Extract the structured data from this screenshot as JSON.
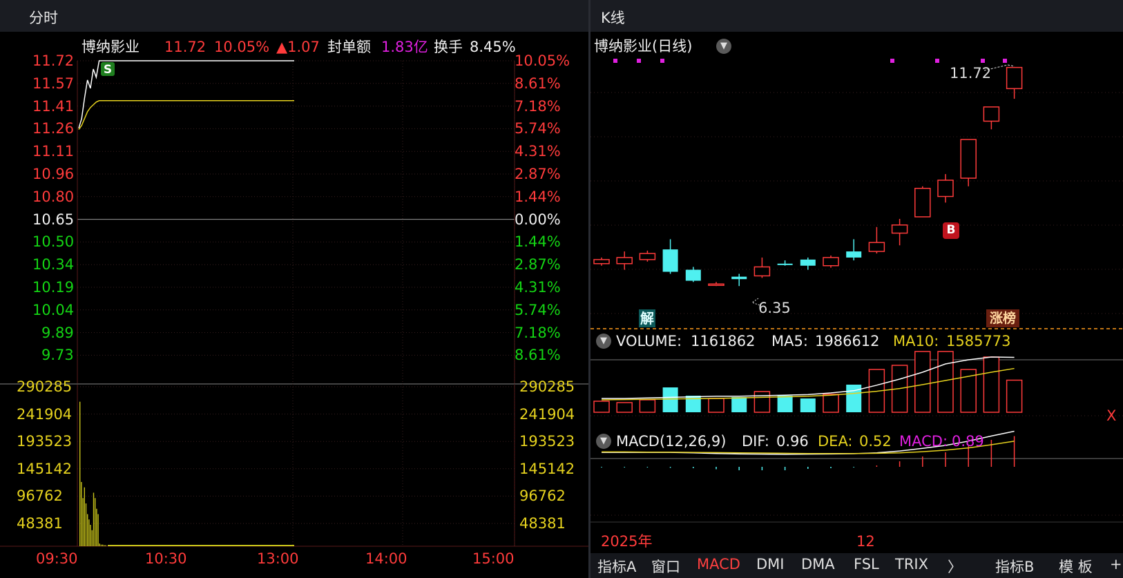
{
  "left_panel": {
    "title": "分时",
    "stock_name": "博纳影业",
    "price": "11.72",
    "pct": "10.05%",
    "change": "▲1.07",
    "seal_label": "封单额",
    "seal_value": "1.83亿",
    "turnover_label": "换手",
    "turnover_value": "8.45%",
    "s_marker": "S",
    "price_ticks_red": [
      "11.72",
      "11.57",
      "11.41",
      "11.26",
      "11.11",
      "10.96",
      "10.80"
    ],
    "price_mid": "10.65",
    "price_ticks_green": [
      "10.50",
      "10.34",
      "10.19",
      "10.04",
      "9.89",
      "9.73"
    ],
    "pct_ticks_red": [
      "10.05%",
      "8.61%",
      "7.18%",
      "5.74%",
      "4.31%",
      "2.87%",
      "1.44%"
    ],
    "pct_mid": "0.00%",
    "pct_ticks_green": [
      "1.44%",
      "2.87%",
      "4.31%",
      "5.74%",
      "7.18%",
      "8.61%"
    ],
    "vol_ticks": [
      "290285",
      "241904",
      "193523",
      "145142",
      "96762",
      "48381"
    ],
    "time_labels": [
      "09:30",
      "10:30",
      "13:00",
      "14:00",
      "15:00"
    ]
  },
  "right_panel": {
    "title": "K线",
    "chart_title": "博纳影业(日线)",
    "high_label": "11.72",
    "low_label": "6.35",
    "jie_badge": "解",
    "b_badge": "B",
    "zhangbang_badge": "涨榜",
    "volume_line": {
      "name": "VOLUME:",
      "value": "1161862",
      "ma5_label": "MA5:",
      "ma5": "1986612",
      "ma10_label": "MA10:",
      "ma10": "1585773"
    },
    "macd_line": {
      "name": "MACD(12,26,9)",
      "dif_label": "DIF:",
      "dif": "0.96",
      "dea_label": "DEA:",
      "dea": "0.52",
      "macd_label": "MACD:",
      "macd": "0.89"
    },
    "date_left": "2025年",
    "date_mid": "12",
    "close_x": "X"
  },
  "tabs": [
    "指标A",
    "窗口",
    "MACD",
    "DMI",
    "DMA",
    "FSL",
    "TRIX",
    "〉",
    "指标B",
    "模 板",
    "+"
  ],
  "active_tab": "MACD",
  "colors": {
    "up": "#ff3b3b",
    "down": "#4ff0f0",
    "price_line": "#ffffff",
    "avg_line": "#e6d21e",
    "volume": "#c8c41a"
  },
  "chart_data": [
    {
      "type": "line",
      "title": "分时",
      "series": [
        {
          "name": "price",
          "values": [
            11.23,
            11.3,
            11.45,
            11.58,
            11.52,
            11.66,
            11.6,
            11.72,
            11.72,
            11.72
          ]
        },
        {
          "name": "avg",
          "values": [
            11.22,
            11.25,
            11.3,
            11.35,
            11.38,
            11.4,
            11.42,
            11.43,
            11.43,
            11.43
          ]
        }
      ],
      "ylim": [
        9.58,
        11.72
      ]
    },
    {
      "type": "bar",
      "title": "分时成交量",
      "values": [
        270000,
        120000,
        90000,
        110000,
        80000,
        60000,
        50000,
        40000,
        30000,
        100000,
        90000,
        70000,
        60000,
        5000,
        3000,
        3000,
        2000,
        2000
      ],
      "ylim": [
        0,
        290285
      ]
    },
    {
      "type": "candlestick",
      "title": "博纳影业(日线)",
      "candles": [
        {
          "o": 6.9,
          "c": 7.0,
          "h": 7.05,
          "l": 6.85,
          "up": true
        },
        {
          "o": 6.9,
          "c": 7.05,
          "h": 7.2,
          "l": 6.75,
          "up": true
        },
        {
          "o": 7.0,
          "c": 7.15,
          "h": 7.22,
          "l": 6.95,
          "up": true
        },
        {
          "o": 7.25,
          "c": 6.7,
          "h": 7.5,
          "l": 6.65,
          "up": false
        },
        {
          "o": 6.75,
          "c": 6.48,
          "h": 6.82,
          "l": 6.45,
          "up": false
        },
        {
          "o": 6.4,
          "c": 6.4,
          "h": 6.45,
          "l": 6.35,
          "up": true
        },
        {
          "o": 6.58,
          "c": 6.52,
          "h": 6.65,
          "l": 6.35,
          "up": false
        },
        {
          "o": 6.6,
          "c": 6.82,
          "h": 7.05,
          "l": 6.55,
          "up": true
        },
        {
          "o": 6.9,
          "c": 6.88,
          "h": 6.98,
          "l": 6.85,
          "up": false
        },
        {
          "o": 7.0,
          "c": 6.85,
          "h": 7.05,
          "l": 6.75,
          "up": false
        },
        {
          "o": 6.85,
          "c": 7.05,
          "h": 7.1,
          "l": 6.8,
          "up": true
        },
        {
          "o": 7.2,
          "c": 7.05,
          "h": 7.5,
          "l": 6.98,
          "up": false
        },
        {
          "o": 7.2,
          "c": 7.42,
          "h": 7.8,
          "l": 7.15,
          "up": true
        },
        {
          "o": 7.65,
          "c": 7.85,
          "h": 8.0,
          "l": 7.35,
          "up": true
        },
        {
          "o": 8.05,
          "c": 8.75,
          "h": 8.8,
          "l": 8.05,
          "up": true
        },
        {
          "o": 8.55,
          "c": 8.95,
          "h": 9.1,
          "l": 8.4,
          "up": true
        },
        {
          "o": 9.0,
          "c": 9.95,
          "h": 9.95,
          "l": 8.8,
          "up": true
        },
        {
          "o": 10.4,
          "c": 10.75,
          "h": 10.75,
          "l": 10.2,
          "up": true
        },
        {
          "o": 11.2,
          "c": 11.72,
          "h": 11.72,
          "l": 10.95,
          "up": true
        }
      ],
      "ylim": [
        6.15,
        11.85
      ]
    },
    {
      "type": "bar",
      "title": "VOLUME",
      "values": [
        400000,
        350000,
        450000,
        900000,
        600000,
        500000,
        550000,
        750000,
        600000,
        500000,
        650000,
        1000000,
        1550000,
        1700000,
        2200000,
        2200000,
        1550000,
        2000000,
        1161862
      ],
      "series": [
        {
          "name": "MA5",
          "values": [
            500000,
            500000,
            520000,
            540000,
            560000,
            580000,
            580000,
            600000,
            620000,
            640000,
            700000,
            780000,
            980000,
            1200000,
            1450000,
            1750000,
            1900000,
            2000000,
            1986612
          ]
        },
        {
          "name": "MA10",
          "values": [
            450000,
            460000,
            470000,
            480000,
            490000,
            500000,
            520000,
            540000,
            560000,
            580000,
            620000,
            680000,
            760000,
            860000,
            1000000,
            1150000,
            1300000,
            1450000,
            1585773
          ]
        }
      ]
    },
    {
      "type": "line",
      "title": "MACD(12,26,9)",
      "series": [
        {
          "name": "DIF",
          "values": [
            0.02,
            0.02,
            0.02,
            0.02,
            0.0,
            -0.03,
            -0.05,
            -0.06,
            -0.07,
            -0.06,
            -0.05,
            -0.04,
            0.0,
            0.08,
            0.2,
            0.33,
            0.52,
            0.75,
            0.96
          ]
        },
        {
          "name": "DEA",
          "values": [
            0.04,
            0.04,
            0.03,
            0.03,
            0.02,
            0.01,
            0.0,
            -0.01,
            -0.02,
            -0.03,
            -0.03,
            -0.03,
            -0.02,
            0.0,
            0.05,
            0.12,
            0.22,
            0.36,
            0.52
          ]
        },
        {
          "name": "MACD",
          "values": [
            -0.02,
            -0.02,
            -0.02,
            -0.03,
            -0.04,
            -0.07,
            -0.1,
            -0.1,
            -0.1,
            -0.06,
            -0.04,
            -0.02,
            0.04,
            0.16,
            0.3,
            0.42,
            0.6,
            0.78,
            0.89
          ]
        }
      ]
    }
  ]
}
